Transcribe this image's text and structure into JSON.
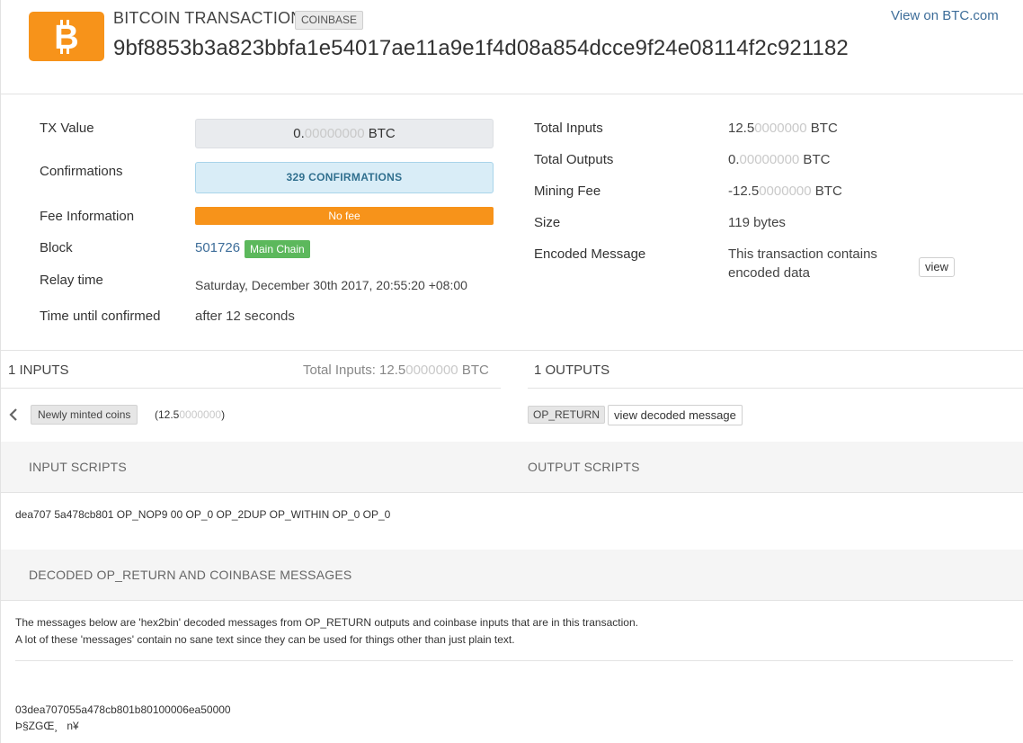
{
  "header": {
    "title": "BITCOIN TRANSACTION",
    "badge": "COINBASE",
    "txid": "9bf8853b3a823bbfa1e54017ae11a9e1f4d08a854dcce9f24e08114f2c921182",
    "view_link": "View on BTC.com"
  },
  "summary_left": {
    "tx_value_label": "TX Value",
    "tx_value_main": "0.",
    "tx_value_dim": "00000000",
    "tx_value_unit": " BTC",
    "confirmations_label": "Confirmations",
    "confirmations_value": "329 CONFIRMATIONS",
    "fee_info_label": "Fee Information",
    "fee_info_value": "No fee",
    "block_label": "Block",
    "block_value": "501726",
    "block_badge": "Main Chain",
    "relay_label": "Relay time",
    "relay_value": "Saturday, December 30th 2017, 20:55:20 +08:00",
    "confirm_time_label": "Time until confirmed",
    "confirm_time_value": "after 12 seconds"
  },
  "summary_right": {
    "total_inputs_label": "Total Inputs",
    "total_inputs_main": "12.5",
    "total_inputs_dim": "0000000",
    "total_outputs_label": "Total Outputs",
    "total_outputs_main": "0.",
    "total_outputs_dim": "00000000",
    "mining_fee_label": "Mining Fee",
    "mining_fee_main": "-12.5",
    "mining_fee_dim": "0000000",
    "unit": " BTC",
    "size_label": "Size",
    "size_value": "119 bytes",
    "encoded_label": "Encoded Message",
    "encoded_line1": "This transaction contains",
    "encoded_line2": "encoded data",
    "view_button": "view"
  },
  "inputs": {
    "heading": "1 INPUTS",
    "total_prefix": "Total Inputs: 12.5",
    "total_dim": "0000000",
    "total_unit": " BTC",
    "item_label": "Newly minted coins",
    "item_amount_prefix": "(12.5",
    "item_amount_dim": "0000000",
    "item_amount_suffix": ")"
  },
  "outputs": {
    "heading": "1 OUTPUTS",
    "item_label": "OP_RETURN",
    "view_decoded": "view decoded message"
  },
  "scripts": {
    "input_title": "INPUT SCRIPTS",
    "output_title": "OUTPUT SCRIPTS",
    "input_script": "dea707 5a478cb801 OP_NOP9 00 OP_0 OP_2DUP OP_WITHIN OP_0 OP_0"
  },
  "decoded": {
    "title": "DECODED OP_RETURN AND COINBASE MESSAGES",
    "desc1": "The messages below are 'hex2bin' decoded messages from OP_RETURN outputs and coinbase inputs that are in this transaction.",
    "desc2": "A lot of these 'messages' contain no sane text since they can be used for things other than just plain text.",
    "hex": "03dea707055a478cb801b80100006ea50000",
    "text": "Þ§ZGŒ¸   n¥"
  }
}
